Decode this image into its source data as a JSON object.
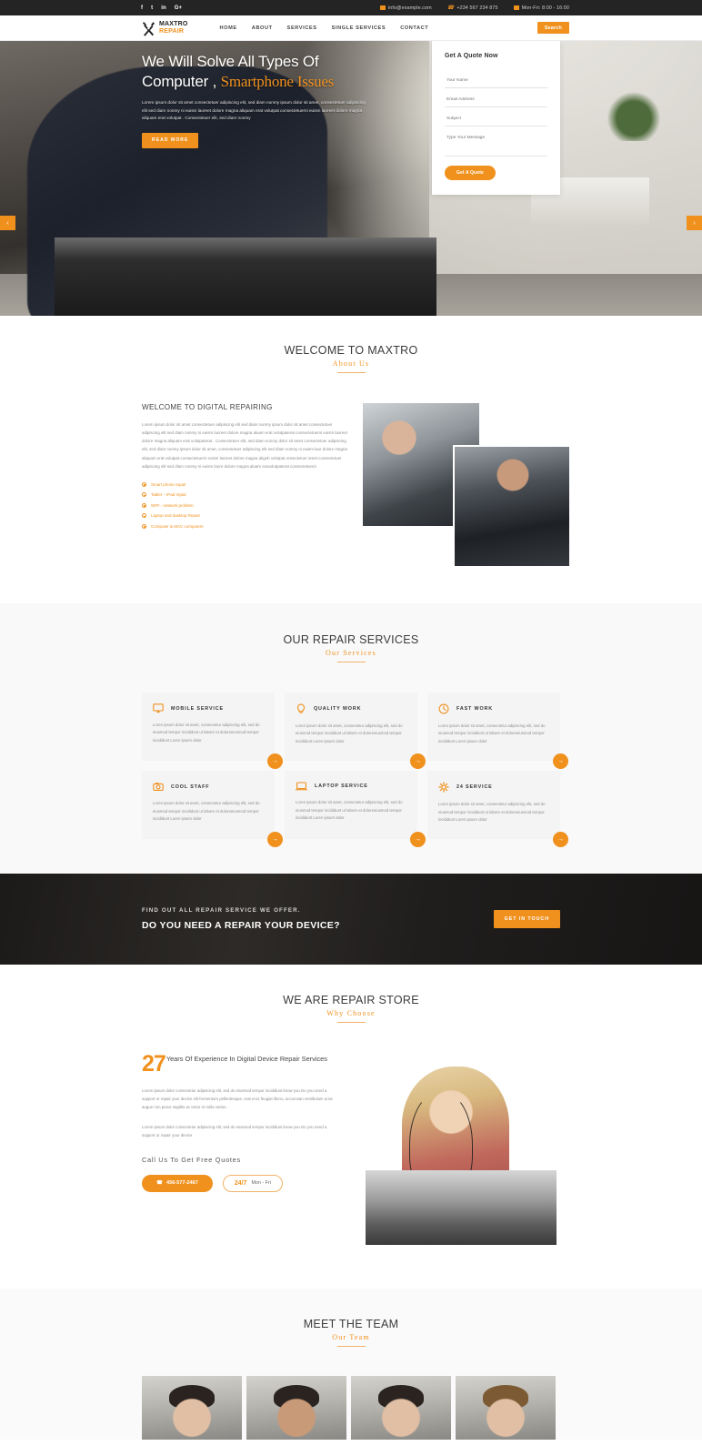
{
  "topbar": {
    "social": [
      "f",
      "t",
      "in",
      "G+"
    ],
    "email": "info@example.com",
    "phone": "+234 567 234 875",
    "hours": "Mon-Fri: 8:00 - 16:00"
  },
  "header": {
    "logo_line1": "MAXTRO",
    "logo_line2": "REPAIR",
    "nav": [
      "HOME",
      "ABOUT",
      "SERVICES",
      "SINGLE SERVICES",
      "CONTACT"
    ],
    "search_label": "Search"
  },
  "hero": {
    "title_line1": "We Will Solve All Types Of",
    "title_line2_plain": "Computer ,",
    "title_line2_accent": "Smartphone Issues",
    "paragraph": "Lorem ipsum dolor sit amet consectetuer adipiscing elit, sed diam nonmy ipsum dolor sit amet, consectetuer adipiscing elit sed diam nonmy ni euism laoreet dolore magna aliquam erat volutpat consectetuerni euism laoreet dolore magna aliquam erat volutpat . Consectetuer elit, sed diam nonmy",
    "button": "READ MORE",
    "arrow_prev": "‹",
    "arrow_next": "›",
    "form": {
      "title": "Get A Quote Now",
      "name_placeholder": "Your Name",
      "email_placeholder": "Email Address",
      "subject_placeholder": "Subject",
      "message_placeholder": "Type Your Message",
      "submit": "Get A Quote"
    }
  },
  "about": {
    "heading_big": "WELCOME TO MAXTRO",
    "heading_small": "About Us",
    "subheading": "WELCOME TO DIGITAL REPAIRING",
    "paragraph": "Lorem ipsum dolor sit amet consectetuer adipiscing elit sed diam nonmy ipsum dolor sit amet consectetuer adipiscing elit sed diam nonmy ni euism laoreet dolore magna aluam erat volutpaterat consectetuerni euism laoreet dolore magna aliquam erat volutpaterat . Consectetuer elit, sed diam nonmy dolor sit amet consectetuer adipiscing elit, sed diam nonmy ipsum dolor sit amet, consectetuer adipiscing elit sed diam nonmy ni euism laor dolore magna aliquam erat volutpat consectetuerni euism laoreet dolore magna alignh volutpat onsectetuer amet consectetuer adipiscing elit sed diam nonmy ni euism laore dolore magna aluam eravolutpaterat consectetuemi",
    "list": [
      "Smart phone repair",
      "Tablet – IPad repair",
      "WIFI - network problem",
      "Laptop and dasktop Repair",
      "Computer & MAC computers"
    ]
  },
  "services": {
    "heading_big": "OUR REPAIR SERVICES",
    "heading_small": "Our Services",
    "card_text": "Loren ipsum dolor sit amet, consectetur adipiscing elit, sed do eiusmod tempor incididunt ut labore et doloreeiusmod tempor incididunt Loren ipsum dolor",
    "arrow": "→",
    "cards": [
      {
        "title": "MOBILE SERVICE",
        "icon": "monitor-icon"
      },
      {
        "title": "QUALITY WORK",
        "icon": "lightbulb-icon"
      },
      {
        "title": "FAST WORK",
        "icon": "clock-icon"
      },
      {
        "title": "COOL STAFF",
        "icon": "camera-icon"
      },
      {
        "title": "LAPTOP SERVICE",
        "icon": "laptop-icon"
      },
      {
        "title": "24 SERVICE",
        "icon": "gear-icon"
      }
    ]
  },
  "cta": {
    "line1": "FIND OUT ALL REPAIR SERVICE WE OFFER.",
    "line2": "DO YOU NEED A REPAIR YOUR DEVICE?",
    "button": "GET IN TOUCH"
  },
  "why": {
    "heading_big": "WE ARE REPAIR STORE",
    "heading_small": "Why Choose",
    "years_number": "27",
    "years_text": "Years Of Experience In Digital Device Repair Services",
    "paragraph1": "Lorem ipsum dolor consectetur adipiscing elit, sed do eiusmod tempor incididunt know you Do you need a support or repair your device elit fermentum pellentesque, erat eros feugiat libero, accumsan vestibulum urna augue non purus sagittis ac tortor et nulla varius.",
    "paragraph2": "Lorem ipsum dolor consectetur adipiscing elit, sed do eiusmod tempor incididunt know you Do you need a support or repair your device",
    "call_heading": "Call Us To Get Free Quotes",
    "phone_button": "456-577-2467",
    "hours_badge": "24/7",
    "hours_text": "Mon - Fri"
  },
  "team": {
    "heading_big": "MEET THE TEAM",
    "heading_small": "Our Team",
    "members": 4
  },
  "colors": {
    "accent": "#f0911e",
    "dark": "#242424",
    "text": "#555555"
  }
}
